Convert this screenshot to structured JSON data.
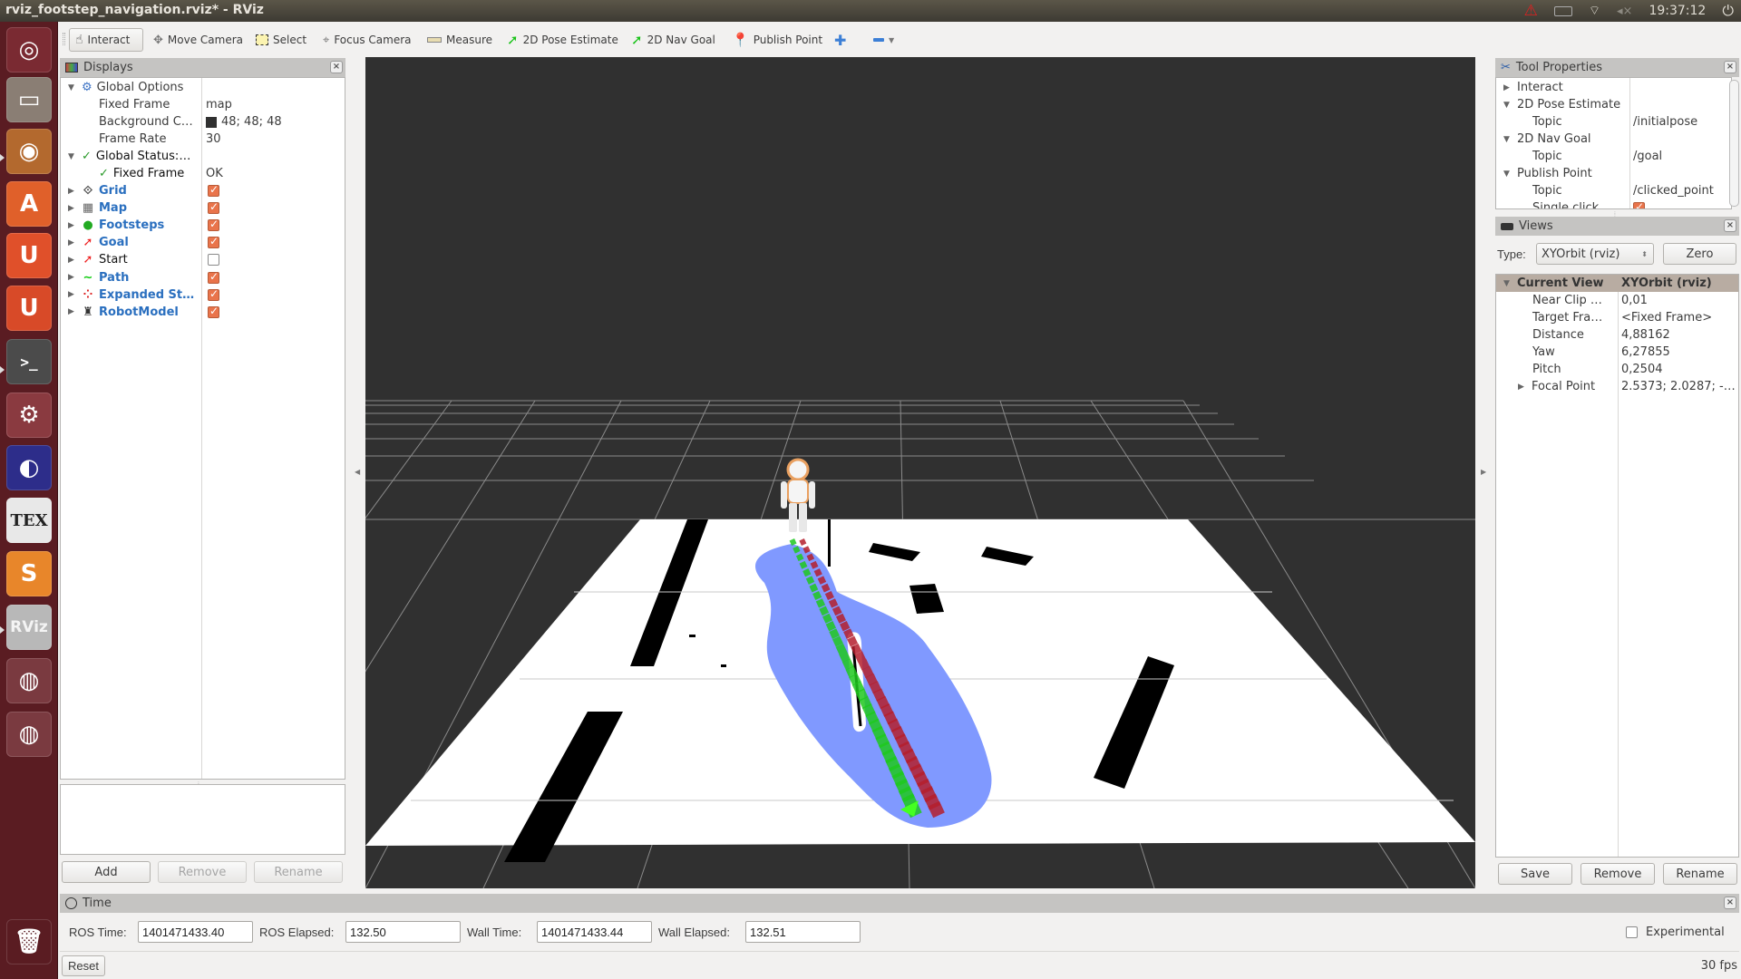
{
  "window": {
    "title": "rviz_footstep_navigation.rviz* - RViz"
  },
  "tray": {
    "clock": "19:37:12",
    "icons": [
      "warning-icon",
      "battery-icon",
      "wifi-icon",
      "volume-muted-icon",
      "power-icon"
    ]
  },
  "launcher": {
    "items": [
      {
        "name": "ubuntu-dash",
        "glyph": "◎",
        "bg": "#7a2a32"
      },
      {
        "name": "files",
        "glyph": "▭",
        "bg": "#8a7e74"
      },
      {
        "name": "firefox",
        "glyph": "◉",
        "bg": "#b3692e"
      },
      {
        "name": "software-center",
        "glyph": "A",
        "bg": "#e0602a"
      },
      {
        "name": "ubuntu-one",
        "glyph": "U",
        "bg": "#e0502a"
      },
      {
        "name": "ubuntu-one-music",
        "glyph": "U",
        "bg": "#d84a28"
      },
      {
        "name": "terminal",
        "glyph": ">_",
        "bg": "#4b4b4b"
      },
      {
        "name": "system-settings",
        "glyph": "⚙",
        "bg": "#8a3a40"
      },
      {
        "name": "eclipse",
        "glyph": "◐",
        "bg": "#2d2d8a"
      },
      {
        "name": "texmaker",
        "glyph": "TEX",
        "bg": "#e8e8e8"
      },
      {
        "name": "meld",
        "glyph": "S",
        "bg": "#e8862a"
      },
      {
        "name": "rviz",
        "glyph": "RViz",
        "bg": "#b8b8b8"
      },
      {
        "name": "drive-1",
        "glyph": "◍",
        "bg": "#7a3a40"
      },
      {
        "name": "drive-2",
        "glyph": "◍",
        "bg": "#7a3a40"
      },
      {
        "name": "trash",
        "glyph": "🗑",
        "bg": "#5a1c22"
      }
    ]
  },
  "toolbar": {
    "tools": [
      {
        "label": "Interact",
        "icon": "hand-pointer-icon",
        "active": true
      },
      {
        "label": "Move Camera",
        "icon": "move-camera-icon"
      },
      {
        "label": "Select",
        "icon": "select-box-icon"
      },
      {
        "label": "Focus Camera",
        "icon": "focus-camera-icon"
      },
      {
        "label": "Measure",
        "icon": "ruler-icon"
      },
      {
        "label": "2D Pose Estimate",
        "icon": "green-arrow-icon"
      },
      {
        "label": "2D Nav Goal",
        "icon": "green-arrow-icon"
      },
      {
        "label": "Publish Point",
        "icon": "map-pin-icon"
      }
    ],
    "add_tool_icon": "plus-icon",
    "remove_tool_icon": "minus-icon"
  },
  "displays": {
    "title": "Displays",
    "global_options": {
      "label": "Global Options",
      "fixed_frame_label": "Fixed Frame",
      "fixed_frame": "map",
      "background_label": "Background C…",
      "background": "48; 48; 48",
      "background_color": "#303030",
      "frame_rate_label": "Frame Rate",
      "frame_rate": "30"
    },
    "global_status": {
      "label": "Global Status:…",
      "fixed_frame_label": "Fixed Frame",
      "fixed_frame": "OK"
    },
    "items": [
      {
        "label": "Grid",
        "checked": true,
        "icon": "grid-icon",
        "blue": true
      },
      {
        "label": "Map",
        "checked": true,
        "icon": "map-icon",
        "blue": true
      },
      {
        "label": "Footsteps",
        "checked": true,
        "icon": "markers-icon",
        "blue": true
      },
      {
        "label": "Goal",
        "checked": true,
        "icon": "pose-arrow-icon",
        "blue": true
      },
      {
        "label": "Start",
        "checked": false,
        "icon": "pose-arrow-icon",
        "blue": false
      },
      {
        "label": "Path",
        "checked": true,
        "icon": "path-icon",
        "blue": true
      },
      {
        "label": "Expanded St…",
        "checked": true,
        "icon": "pointcloud-icon",
        "blue": true
      },
      {
        "label": "RobotModel",
        "checked": true,
        "icon": "robot-icon",
        "blue": true
      }
    ],
    "buttons": {
      "add": "Add",
      "remove": "Remove",
      "rename": "Rename"
    }
  },
  "tool_properties": {
    "title": "Tool Properties",
    "rows": [
      {
        "key": "Interact",
        "value": "",
        "level": 0,
        "arrow": "right"
      },
      {
        "key": "2D Pose Estimate",
        "value": "",
        "level": 0,
        "arrow": "down"
      },
      {
        "key": "Topic",
        "value": "/initialpose",
        "level": 1
      },
      {
        "key": "2D Nav Goal",
        "value": "",
        "level": 0,
        "arrow": "down"
      },
      {
        "key": "Topic",
        "value": "/goal",
        "level": 1
      },
      {
        "key": "Publish Point",
        "value": "",
        "level": 0,
        "arrow": "down"
      },
      {
        "key": "Topic",
        "value": "/clicked_point",
        "level": 1
      },
      {
        "key": "Single click",
        "value": "",
        "level": 1,
        "checkbox": true
      }
    ]
  },
  "views": {
    "title": "Views",
    "type_label": "Type:",
    "type_value": "XYOrbit (rviz)",
    "zero": "Zero",
    "current_view": {
      "key": "Current View",
      "value": "XYOrbit (rviz)"
    },
    "rows": [
      {
        "key": "Near Clip …",
        "value": "0,01"
      },
      {
        "key": "Target Fra…",
        "value": "<Fixed Frame>"
      },
      {
        "key": "Distance",
        "value": "4,88162"
      },
      {
        "key": "Yaw",
        "value": "6,27855"
      },
      {
        "key": "Pitch",
        "value": "0,2504"
      },
      {
        "key": "Focal Point",
        "value": "2.5373; 2.0287; -…",
        "arrow": "right"
      }
    ],
    "buttons": {
      "save": "Save",
      "remove": "Remove",
      "rename": "Rename"
    }
  },
  "time": {
    "title": "Time",
    "ros_time_label": "ROS Time:",
    "ros_time": "1401471433.40",
    "ros_elapsed_label": "ROS Elapsed:",
    "ros_elapsed": "132.50",
    "wall_time_label": "Wall Time:",
    "wall_time": "1401471433.44",
    "wall_elapsed_label": "Wall Elapsed:",
    "wall_elapsed": "132.51",
    "experimental_label": "Experimental",
    "experimental": false,
    "reset": "Reset",
    "fps": "30 fps"
  },
  "scene": {
    "background": "#303030",
    "map_free_color": "#ffffff",
    "map_occupied_color": "#000000",
    "expanded_states_color": "#8099ff",
    "left_foot_color": "#1ec81e",
    "right_foot_color": "#b41e2d",
    "footstep_count": 36
  }
}
